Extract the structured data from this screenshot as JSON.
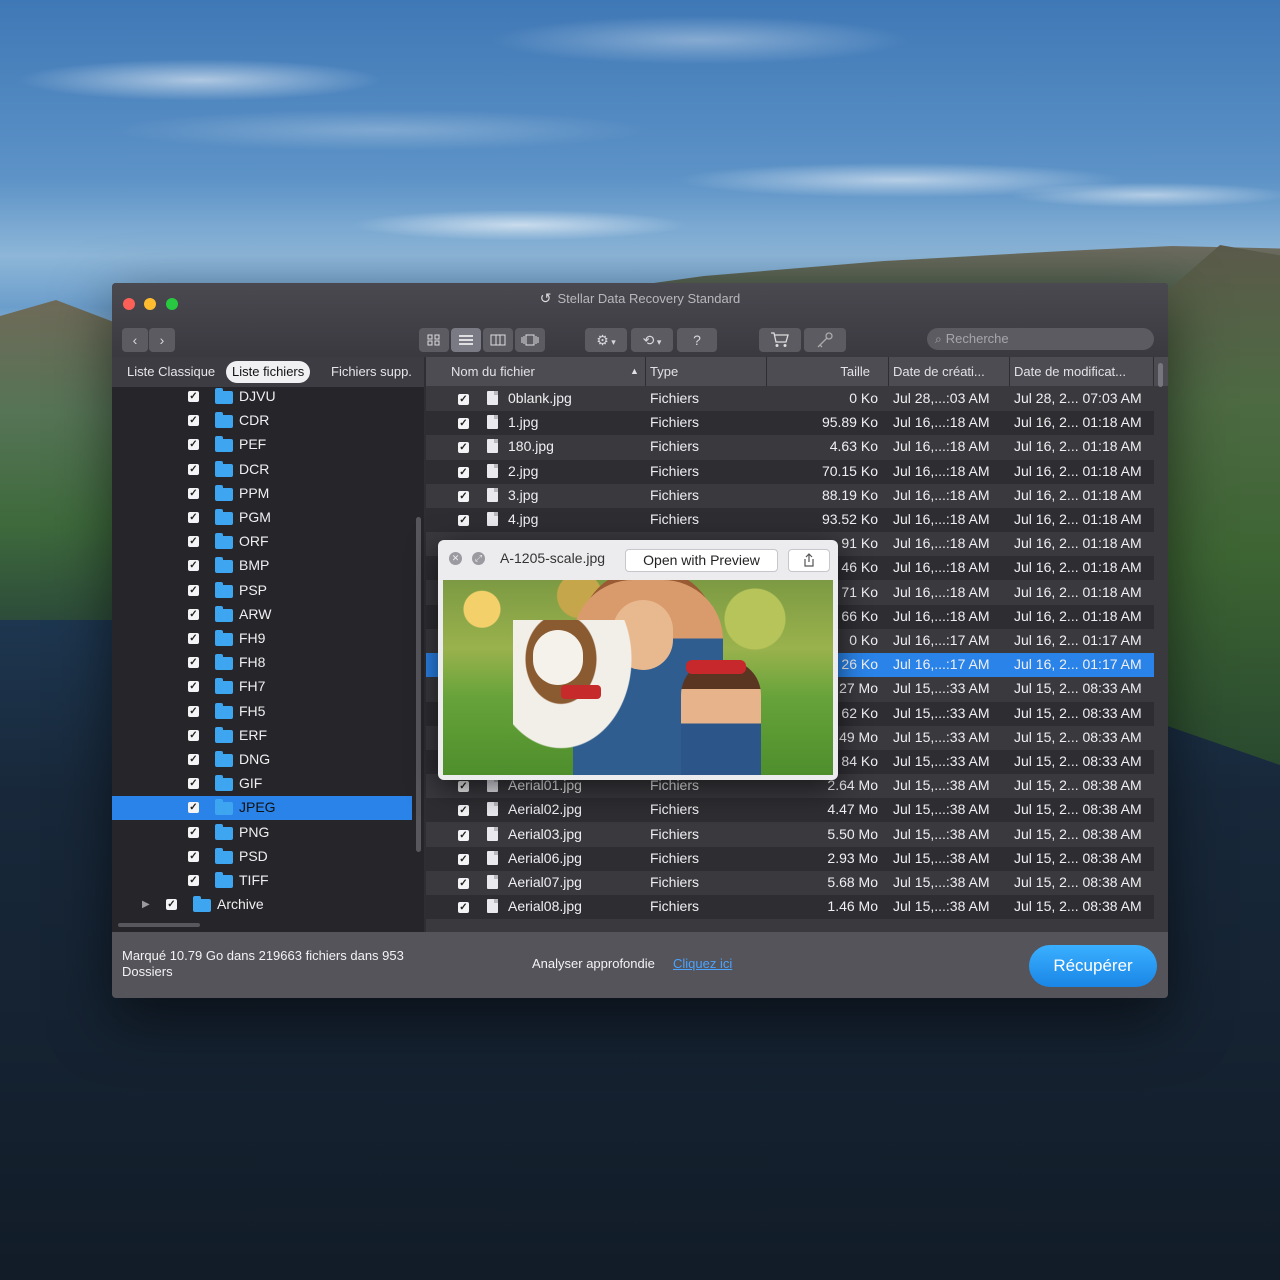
{
  "window": {
    "title": "Stellar Data Recovery Standard"
  },
  "toolbar": {
    "back_icon": "‹",
    "forward_icon": "›",
    "search_placeholder": "Recherche"
  },
  "sidebar": {
    "tabs": [
      {
        "label": "Liste Classique"
      },
      {
        "label": "Liste fichiers"
      },
      {
        "label": "Fichiers supp."
      }
    ],
    "selected_tab": "Liste fichiers",
    "folders": [
      {
        "label": "DJVU"
      },
      {
        "label": "CDR"
      },
      {
        "label": "PEF"
      },
      {
        "label": "DCR"
      },
      {
        "label": "PPM"
      },
      {
        "label": "PGM"
      },
      {
        "label": "ORF"
      },
      {
        "label": "BMP"
      },
      {
        "label": "PSP"
      },
      {
        "label": "ARW"
      },
      {
        "label": "FH9"
      },
      {
        "label": "FH8"
      },
      {
        "label": "FH7"
      },
      {
        "label": "FH5"
      },
      {
        "label": "ERF"
      },
      {
        "label": "DNG"
      },
      {
        "label": "GIF"
      },
      {
        "label": "JPEG"
      },
      {
        "label": "PNG"
      },
      {
        "label": "PSD"
      },
      {
        "label": "TIFF"
      }
    ],
    "selected_folder": "JPEG",
    "archive_label": "Archive"
  },
  "table": {
    "headers": {
      "name": "Nom du fichier",
      "type": "Type",
      "size": "Taille",
      "created": "Date de créati...",
      "modified": "Date de modificat..."
    },
    "rows": [
      {
        "name": "0blank.jpg",
        "type": "Fichiers",
        "size": "0  Ko",
        "created": "Jul 28,...:03 AM",
        "modified": "Jul 28, 2... 07:03 AM"
      },
      {
        "name": "1.jpg",
        "type": "Fichiers",
        "size": "95.89 Ko",
        "created": "Jul 16,...:18 AM",
        "modified": "Jul 16, 2... 01:18 AM"
      },
      {
        "name": "180.jpg",
        "type": "Fichiers",
        "size": "4.63 Ko",
        "created": "Jul 16,...:18 AM",
        "modified": "Jul 16, 2... 01:18 AM"
      },
      {
        "name": "2.jpg",
        "type": "Fichiers",
        "size": "70.15 Ko",
        "created": "Jul 16,...:18 AM",
        "modified": "Jul 16, 2... 01:18 AM"
      },
      {
        "name": "3.jpg",
        "type": "Fichiers",
        "size": "88.19 Ko",
        "created": "Jul 16,...:18 AM",
        "modified": "Jul 16, 2... 01:18 AM"
      },
      {
        "name": "4.jpg",
        "type": "Fichiers",
        "size": "93.52 Ko",
        "created": "Jul 16,...:18 AM",
        "modified": "Jul 16, 2... 01:18 AM"
      },
      {
        "name": "",
        "type": "",
        "size": "91 Ko",
        "created": "Jul 16,...:18 AM",
        "modified": "Jul 16, 2... 01:18 AM"
      },
      {
        "name": "",
        "type": "",
        "size": "46 Ko",
        "created": "Jul 16,...:18 AM",
        "modified": "Jul 16, 2... 01:18 AM"
      },
      {
        "name": "",
        "type": "",
        "size": "71 Ko",
        "created": "Jul 16,...:18 AM",
        "modified": "Jul 16, 2... 01:18 AM"
      },
      {
        "name": "",
        "type": "",
        "size": "66 Ko",
        "created": "Jul 16,...:18 AM",
        "modified": "Jul 16, 2... 01:18 AM"
      },
      {
        "name": "",
        "type": "",
        "size": "0  Ko",
        "created": "Jul 16,...:17 AM",
        "modified": "Jul 16, 2... 01:17 AM"
      },
      {
        "name": "",
        "type": "",
        "size": "26 Ko",
        "created": "Jul 16,...:17 AM",
        "modified": "Jul 16, 2... 01:17 AM"
      },
      {
        "name": "",
        "type": "",
        "size": "27 Mo",
        "created": "Jul 15,...:33 AM",
        "modified": "Jul 15, 2... 08:33 AM"
      },
      {
        "name": "",
        "type": "",
        "size": "62 Ko",
        "created": "Jul 15,...:33 AM",
        "modified": "Jul 15, 2... 08:33 AM"
      },
      {
        "name": "",
        "type": "",
        "size": "49 Mo",
        "created": "Jul 15,...:33 AM",
        "modified": "Jul 15, 2... 08:33 AM"
      },
      {
        "name": "",
        "type": "",
        "size": "84 Ko",
        "created": "Jul 15,...:33 AM",
        "modified": "Jul 15, 2... 08:33 AM"
      },
      {
        "name": "Aerial01.jpg",
        "type": "Fichiers",
        "size": "2.64 Mo",
        "created": "Jul 15,...:38 AM",
        "modified": "Jul 15, 2... 08:38 AM"
      },
      {
        "name": "Aerial02.jpg",
        "type": "Fichiers",
        "size": "4.47 Mo",
        "created": "Jul 15,...:38 AM",
        "modified": "Jul 15, 2... 08:38 AM"
      },
      {
        "name": "Aerial03.jpg",
        "type": "Fichiers",
        "size": "5.50 Mo",
        "created": "Jul 15,...:38 AM",
        "modified": "Jul 15, 2... 08:38 AM"
      },
      {
        "name": "Aerial06.jpg",
        "type": "Fichiers",
        "size": "2.93 Mo",
        "created": "Jul 15,...:38 AM",
        "modified": "Jul 15, 2... 08:38 AM"
      },
      {
        "name": "Aerial07.jpg",
        "type": "Fichiers",
        "size": "5.68 Mo",
        "created": "Jul 15,...:38 AM",
        "modified": "Jul 15, 2... 08:38 AM"
      },
      {
        "name": "Aerial08.jpg",
        "type": "Fichiers",
        "size": "1.46 Mo",
        "created": "Jul 15,...:38 AM",
        "modified": "Jul 15, 2... 08:38 AM"
      }
    ],
    "selected_row": 11
  },
  "preview": {
    "filename": "A-1205-scale.jpg",
    "open_button": "Open with Preview",
    "share_icon": "share-icon"
  },
  "footer": {
    "summary": "Marqué 10.79 Go dans 219663 fichiers dans 953 Dossiers",
    "deep_scan_label": "Analyser approfondie",
    "deep_scan_link": "Cliquez ici",
    "recover_button": "Récupérer"
  },
  "colors": {
    "accent": "#2a83e8",
    "recover": "#1a86e6",
    "link": "#4aa3ff"
  }
}
